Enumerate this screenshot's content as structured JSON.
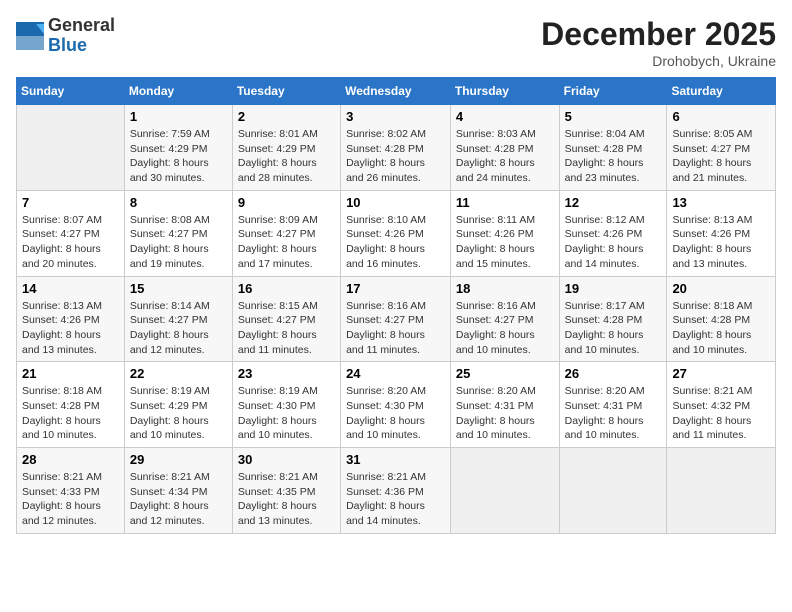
{
  "header": {
    "logo_general": "General",
    "logo_blue": "Blue",
    "month_title": "December 2025",
    "location": "Drohobych, Ukraine"
  },
  "weekdays": [
    "Sunday",
    "Monday",
    "Tuesday",
    "Wednesday",
    "Thursday",
    "Friday",
    "Saturday"
  ],
  "weeks": [
    [
      {
        "day": "",
        "sunrise": "",
        "sunset": "",
        "daylight": ""
      },
      {
        "day": "1",
        "sunrise": "7:59 AM",
        "sunset": "4:29 PM",
        "daylight": "8 hours and 30 minutes."
      },
      {
        "day": "2",
        "sunrise": "8:01 AM",
        "sunset": "4:29 PM",
        "daylight": "8 hours and 28 minutes."
      },
      {
        "day": "3",
        "sunrise": "8:02 AM",
        "sunset": "4:28 PM",
        "daylight": "8 hours and 26 minutes."
      },
      {
        "day": "4",
        "sunrise": "8:03 AM",
        "sunset": "4:28 PM",
        "daylight": "8 hours and 24 minutes."
      },
      {
        "day": "5",
        "sunrise": "8:04 AM",
        "sunset": "4:28 PM",
        "daylight": "8 hours and 23 minutes."
      },
      {
        "day": "6",
        "sunrise": "8:05 AM",
        "sunset": "4:27 PM",
        "daylight": "8 hours and 21 minutes."
      }
    ],
    [
      {
        "day": "7",
        "sunrise": "8:07 AM",
        "sunset": "4:27 PM",
        "daylight": "8 hours and 20 minutes."
      },
      {
        "day": "8",
        "sunrise": "8:08 AM",
        "sunset": "4:27 PM",
        "daylight": "8 hours and 19 minutes."
      },
      {
        "day": "9",
        "sunrise": "8:09 AM",
        "sunset": "4:27 PM",
        "daylight": "8 hours and 17 minutes."
      },
      {
        "day": "10",
        "sunrise": "8:10 AM",
        "sunset": "4:26 PM",
        "daylight": "8 hours and 16 minutes."
      },
      {
        "day": "11",
        "sunrise": "8:11 AM",
        "sunset": "4:26 PM",
        "daylight": "8 hours and 15 minutes."
      },
      {
        "day": "12",
        "sunrise": "8:12 AM",
        "sunset": "4:26 PM",
        "daylight": "8 hours and 14 minutes."
      },
      {
        "day": "13",
        "sunrise": "8:13 AM",
        "sunset": "4:26 PM",
        "daylight": "8 hours and 13 minutes."
      }
    ],
    [
      {
        "day": "14",
        "sunrise": "8:13 AM",
        "sunset": "4:26 PM",
        "daylight": "8 hours and 13 minutes."
      },
      {
        "day": "15",
        "sunrise": "8:14 AM",
        "sunset": "4:27 PM",
        "daylight": "8 hours and 12 minutes."
      },
      {
        "day": "16",
        "sunrise": "8:15 AM",
        "sunset": "4:27 PM",
        "daylight": "8 hours and 11 minutes."
      },
      {
        "day": "17",
        "sunrise": "8:16 AM",
        "sunset": "4:27 PM",
        "daylight": "8 hours and 11 minutes."
      },
      {
        "day": "18",
        "sunrise": "8:16 AM",
        "sunset": "4:27 PM",
        "daylight": "8 hours and 10 minutes."
      },
      {
        "day": "19",
        "sunrise": "8:17 AM",
        "sunset": "4:28 PM",
        "daylight": "8 hours and 10 minutes."
      },
      {
        "day": "20",
        "sunrise": "8:18 AM",
        "sunset": "4:28 PM",
        "daylight": "8 hours and 10 minutes."
      }
    ],
    [
      {
        "day": "21",
        "sunrise": "8:18 AM",
        "sunset": "4:28 PM",
        "daylight": "8 hours and 10 minutes."
      },
      {
        "day": "22",
        "sunrise": "8:19 AM",
        "sunset": "4:29 PM",
        "daylight": "8 hours and 10 minutes."
      },
      {
        "day": "23",
        "sunrise": "8:19 AM",
        "sunset": "4:30 PM",
        "daylight": "8 hours and 10 minutes."
      },
      {
        "day": "24",
        "sunrise": "8:20 AM",
        "sunset": "4:30 PM",
        "daylight": "8 hours and 10 minutes."
      },
      {
        "day": "25",
        "sunrise": "8:20 AM",
        "sunset": "4:31 PM",
        "daylight": "8 hours and 10 minutes."
      },
      {
        "day": "26",
        "sunrise": "8:20 AM",
        "sunset": "4:31 PM",
        "daylight": "8 hours and 10 minutes."
      },
      {
        "day": "27",
        "sunrise": "8:21 AM",
        "sunset": "4:32 PM",
        "daylight": "8 hours and 11 minutes."
      }
    ],
    [
      {
        "day": "28",
        "sunrise": "8:21 AM",
        "sunset": "4:33 PM",
        "daylight": "8 hours and 12 minutes."
      },
      {
        "day": "29",
        "sunrise": "8:21 AM",
        "sunset": "4:34 PM",
        "daylight": "8 hours and 12 minutes."
      },
      {
        "day": "30",
        "sunrise": "8:21 AM",
        "sunset": "4:35 PM",
        "daylight": "8 hours and 13 minutes."
      },
      {
        "day": "31",
        "sunrise": "8:21 AM",
        "sunset": "4:36 PM",
        "daylight": "8 hours and 14 minutes."
      },
      {
        "day": "",
        "sunrise": "",
        "sunset": "",
        "daylight": ""
      },
      {
        "day": "",
        "sunrise": "",
        "sunset": "",
        "daylight": ""
      },
      {
        "day": "",
        "sunrise": "",
        "sunset": "",
        "daylight": ""
      }
    ]
  ],
  "labels": {
    "sunrise": "Sunrise:",
    "sunset": "Sunset:",
    "daylight": "Daylight:"
  }
}
